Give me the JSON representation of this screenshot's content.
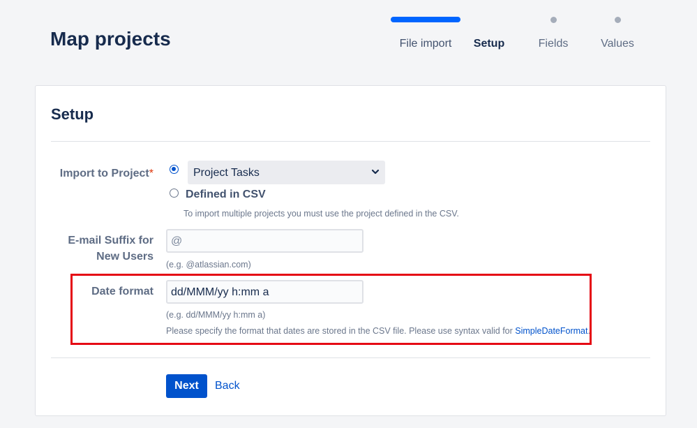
{
  "page": {
    "title": "Map projects"
  },
  "steps": [
    {
      "label": "File import",
      "state": "done"
    },
    {
      "label": "Setup",
      "state": "current"
    },
    {
      "label": "Fields",
      "state": "upcoming"
    },
    {
      "label": "Values",
      "state": "upcoming"
    }
  ],
  "card": {
    "title": "Setup",
    "import_project": {
      "label": "Import to Project",
      "required_marker": "*",
      "option_selected": true,
      "select_value": "Project Tasks",
      "csv_option_label": "Defined in CSV",
      "help": "To import multiple projects you must use the project defined in the CSV."
    },
    "email_suffix": {
      "label_line1": "E-mail Suffix for",
      "label_line2": "New Users",
      "value": "@",
      "help": "(e.g. @atlassian.com)"
    },
    "date_format": {
      "label": "Date format",
      "value": "dd/MMM/yy h:mm a",
      "example": "(e.g. dd/MMM/yy h:mm a)",
      "help_text": "Please specify the format that dates are stored in the CSV file. Please use syntax valid for ",
      "help_link": "SimpleDateFormat",
      "help_end": "."
    },
    "buttons": {
      "next": "Next",
      "back": "Back"
    }
  },
  "colors": {
    "primary": "#0052cc",
    "highlight_border": "#e50914",
    "progress": "#0065ff"
  },
  "icons": {
    "select_arrow": "chevron-down-icon"
  }
}
